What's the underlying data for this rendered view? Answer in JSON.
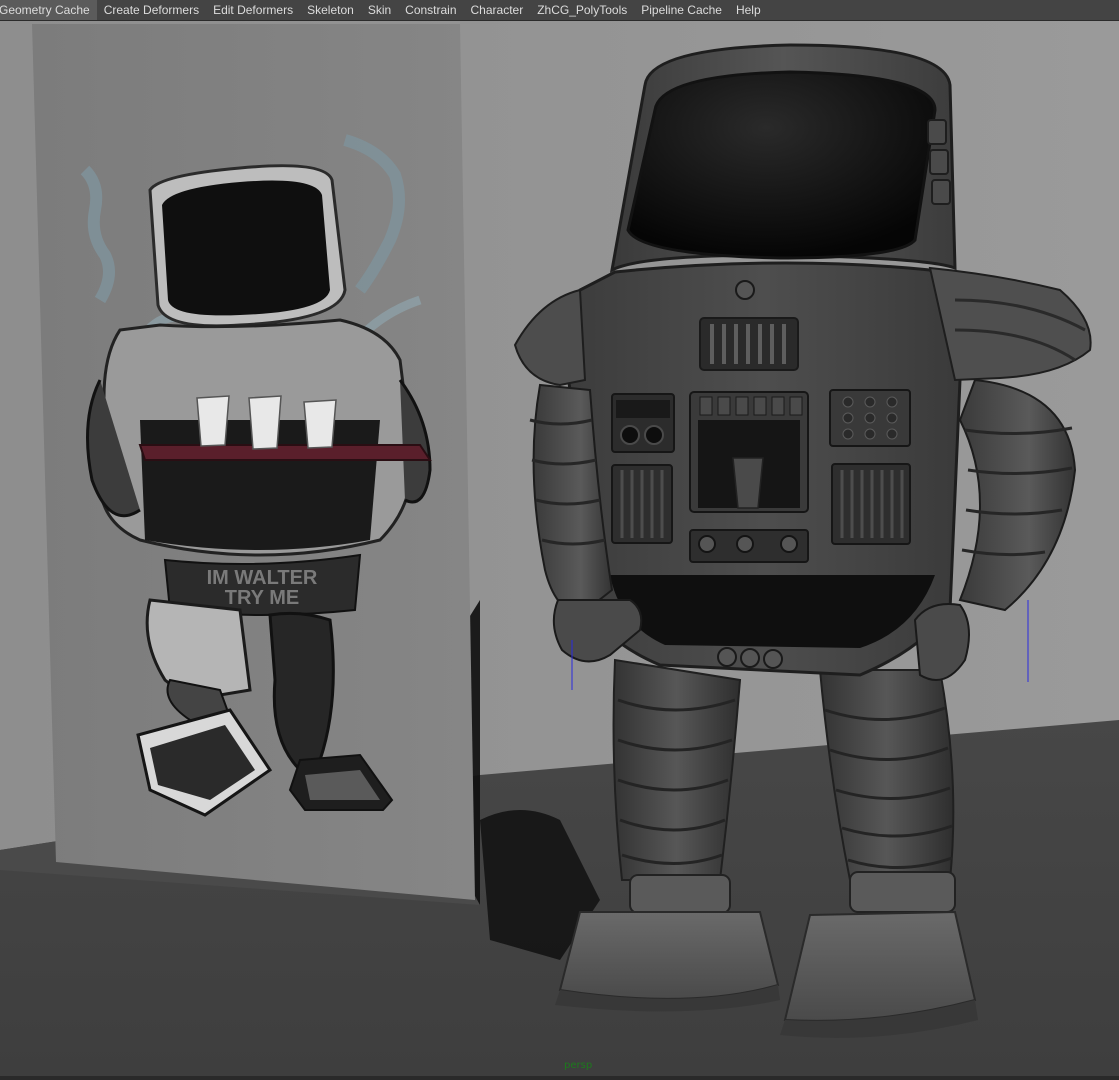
{
  "menubar": {
    "items": [
      "Geometry Cache",
      "Create Deformers",
      "Edit Deformers",
      "Skeleton",
      "Skin",
      "Constrain",
      "Character",
      "ZhCG_PolyTools",
      "Pipeline Cache",
      "Help"
    ]
  },
  "viewport": {
    "camera": "persp",
    "camera_color": "#1c7a1c",
    "background_color": "#8a8a8a"
  },
  "reference_card": {
    "sign_line1": "IM WALTER",
    "sign_line2": "TRY ME"
  }
}
